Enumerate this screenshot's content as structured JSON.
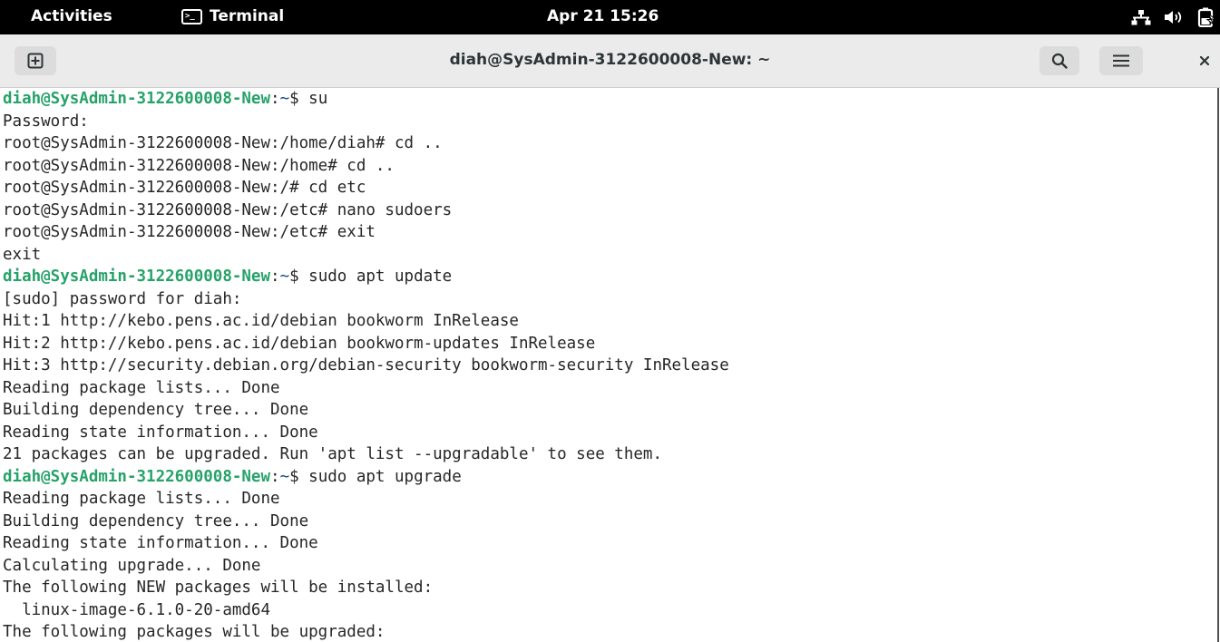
{
  "topbar": {
    "activities": "Activities",
    "app_name": "Terminal",
    "app_icon_glyph": ">_",
    "clock": "Apr 21  15:26",
    "icons": [
      "network-wired-icon",
      "volume-icon",
      "battery-charging-icon"
    ]
  },
  "window": {
    "title": "diah@SysAdmin-3122600008-New: ~",
    "buttons": [
      "new-tab-icon",
      "search-icon",
      "hamburger-menu-icon",
      "close-icon"
    ]
  },
  "colors": {
    "prompt_user": "#26a269",
    "prompt_path": "#12488b",
    "text": "#262626",
    "topbar_bg": "#000000",
    "headerbar_bg": "#ebebeb"
  },
  "terminal": {
    "lines": [
      {
        "type": "prompt",
        "user": "diah@SysAdmin-3122600008-New",
        "sep": ":",
        "path": "~",
        "tail": "$ su"
      },
      {
        "type": "text",
        "text": "Password:"
      },
      {
        "type": "text",
        "text": "root@SysAdmin-3122600008-New:/home/diah# cd .."
      },
      {
        "type": "text",
        "text": "root@SysAdmin-3122600008-New:/home# cd .."
      },
      {
        "type": "text",
        "text": "root@SysAdmin-3122600008-New:/# cd etc"
      },
      {
        "type": "text",
        "text": "root@SysAdmin-3122600008-New:/etc# nano sudoers"
      },
      {
        "type": "text",
        "text": "root@SysAdmin-3122600008-New:/etc# exit"
      },
      {
        "type": "text",
        "text": "exit"
      },
      {
        "type": "prompt",
        "user": "diah@SysAdmin-3122600008-New",
        "sep": ":",
        "path": "~",
        "tail": "$ sudo apt update"
      },
      {
        "type": "text",
        "text": "[sudo] password for diah:"
      },
      {
        "type": "text",
        "text": "Hit:1 http://kebo.pens.ac.id/debian bookworm InRelease"
      },
      {
        "type": "text",
        "text": "Hit:2 http://kebo.pens.ac.id/debian bookworm-updates InRelease"
      },
      {
        "type": "text",
        "text": "Hit:3 http://security.debian.org/debian-security bookworm-security InRelease"
      },
      {
        "type": "text",
        "text": "Reading package lists... Done"
      },
      {
        "type": "text",
        "text": "Building dependency tree... Done"
      },
      {
        "type": "text",
        "text": "Reading state information... Done"
      },
      {
        "type": "text",
        "text": "21 packages can be upgraded. Run 'apt list --upgradable' to see them."
      },
      {
        "type": "prompt",
        "user": "diah@SysAdmin-3122600008-New",
        "sep": ":",
        "path": "~",
        "tail": "$ sudo apt upgrade"
      },
      {
        "type": "text",
        "text": "Reading package lists... Done"
      },
      {
        "type": "text",
        "text": "Building dependency tree... Done"
      },
      {
        "type": "text",
        "text": "Reading state information... Done"
      },
      {
        "type": "text",
        "text": "Calculating upgrade... Done"
      },
      {
        "type": "text",
        "text": "The following NEW packages will be installed:"
      },
      {
        "type": "text",
        "text": "  linux-image-6.1.0-20-amd64"
      },
      {
        "type": "text",
        "text": "The following packages will be upgraded:"
      }
    ]
  }
}
